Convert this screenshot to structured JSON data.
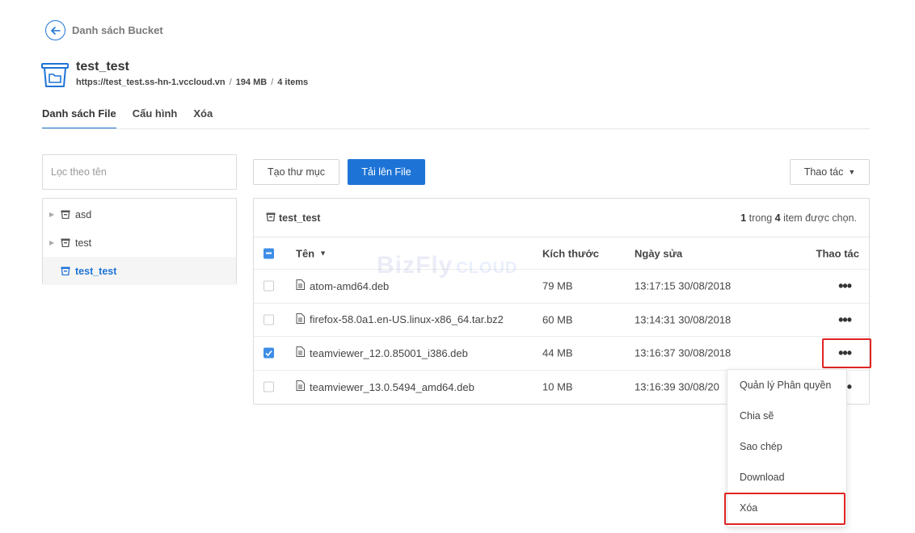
{
  "back": {
    "label": "Danh sách Bucket"
  },
  "bucket": {
    "name": "test_test",
    "url": "https://test_test.ss-hn-1.vccloud.vn",
    "size": "194 MB",
    "items": "4 items"
  },
  "tabs": [
    {
      "label": "Danh sách File",
      "active": true
    },
    {
      "label": "Cấu hình"
    },
    {
      "label": "Xóa"
    }
  ],
  "filter": {
    "placeholder": "Lọc theo tên"
  },
  "tree": [
    {
      "label": "asd"
    },
    {
      "label": "test"
    },
    {
      "label": "test_test",
      "active": true
    }
  ],
  "toolbar": {
    "new_folder": "Tạo thư mục",
    "upload": "Tải lên File",
    "actions": "Thao tác"
  },
  "panel": {
    "path": "test_test",
    "selected_count": "1",
    "selected_mid": "trong",
    "total_count": "4",
    "selected_suffix": "item được chọn."
  },
  "table": {
    "headers": {
      "name": "Tên",
      "size": "Kích thước",
      "date": "Ngày sửa",
      "actions": "Thao tác"
    },
    "rows": [
      {
        "name": "atom-amd64.deb",
        "size": "79 MB",
        "date": "13:17:15 30/08/2018",
        "checked": false
      },
      {
        "name": "firefox-58.0a1.en-US.linux-x86_64.tar.bz2",
        "size": "60 MB",
        "date": "13:14:31 30/08/2018",
        "checked": false
      },
      {
        "name": "teamviewer_12.0.85001_i386.deb",
        "size": "44 MB",
        "date": "13:16:37 30/08/2018",
        "checked": true
      },
      {
        "name": "teamviewer_13.0.5494_amd64.deb",
        "size": "10 MB",
        "date": "13:16:39 30/08/20",
        "checked": false
      }
    ],
    "dots": "•••"
  },
  "watermark": {
    "brand": "BizFly",
    "suffix": "CLOUD"
  },
  "menu": {
    "items": [
      "Quản lý Phân quyền",
      "Chia sẽ",
      "Sao chép",
      "Download",
      "Xóa"
    ]
  },
  "colors": {
    "accent": "#1e74d6",
    "highlight": "#e02424",
    "checkbox": "#3d8de6"
  }
}
